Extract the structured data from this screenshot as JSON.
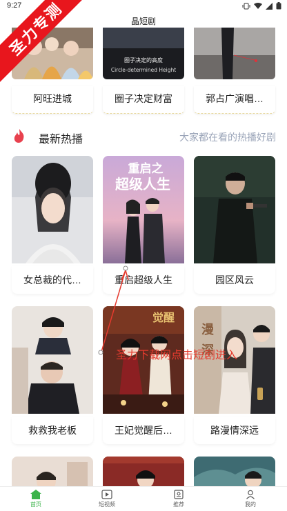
{
  "status_bar": {
    "time": "9:27"
  },
  "header": {
    "title": "晶短剧"
  },
  "watermark": {
    "text": "圣力专测"
  },
  "top_row": [
    {
      "title": "阿旺进城",
      "thumb_text": ""
    },
    {
      "title": "圈子决定财富",
      "thumb_text": "圈子决定的高度",
      "thumb_subtext": "Circle-determined Height"
    },
    {
      "title": "郭占广演唱…",
      "thumb_text": ""
    }
  ],
  "section": {
    "title": "最新热播",
    "subtitle": "大家都在看的热播好剧"
  },
  "grid": [
    {
      "title": "女总裁的代…"
    },
    {
      "title": "重启超级人生",
      "poster_text": "重启之超级人生"
    },
    {
      "title": "园区风云"
    },
    {
      "title": "救救我老板"
    },
    {
      "title": "王妃觉醒后…"
    },
    {
      "title": "路漫情深远",
      "poster_text": "漫深"
    }
  ],
  "annotation": {
    "text": "圣力下载网点击短剧进入"
  },
  "bottom_nav": [
    {
      "label": "首页",
      "icon": "home-icon",
      "active": true
    },
    {
      "label": "短视频",
      "icon": "video-icon",
      "active": false
    },
    {
      "label": "推荐",
      "icon": "recommend-icon",
      "active": false
    },
    {
      "label": "我的",
      "icon": "user-icon",
      "active": false
    }
  ],
  "colors": {
    "accent": "#3bb34a",
    "annotation": "#e53a2e",
    "watermark": "#e8161d",
    "subtitle": "#9aa4b8"
  }
}
